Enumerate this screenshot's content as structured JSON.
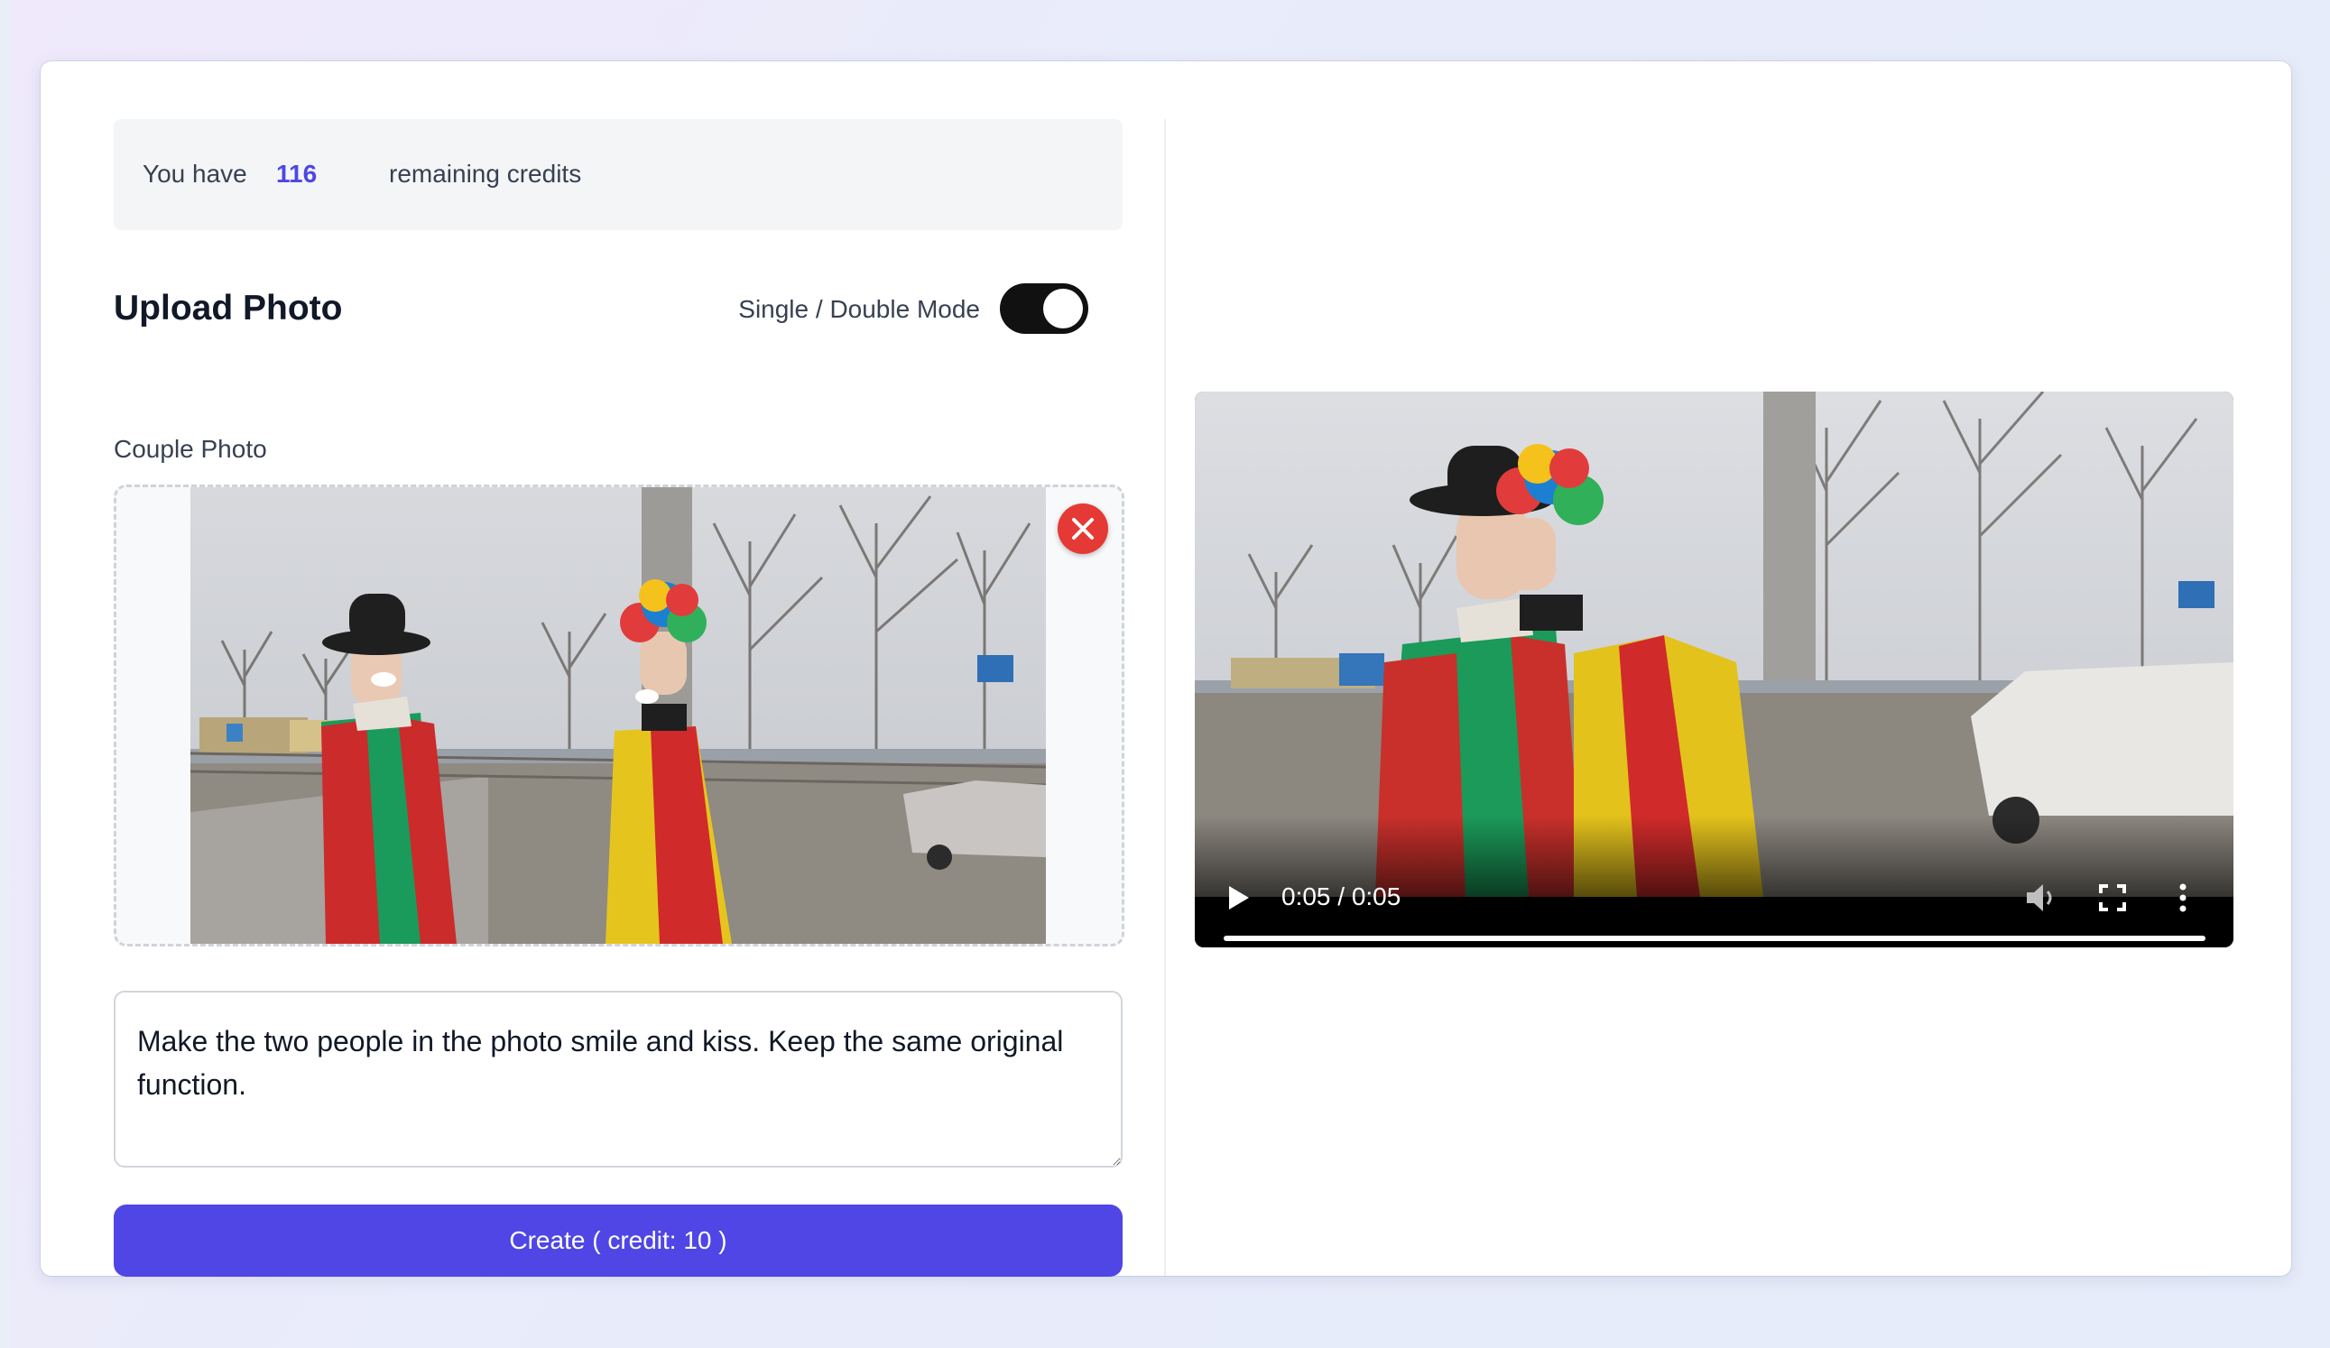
{
  "credits": {
    "prefix": "You have",
    "count": "116",
    "suffix": "remaining credits"
  },
  "upload": {
    "title": "Upload Photo",
    "mode_label": "Single / Double Mode",
    "mode_on": true,
    "photo_label": "Couple Photo"
  },
  "prompt": {
    "value": "Make the two people in the photo smile and kiss. Keep the same original function."
  },
  "create_button": {
    "label": "Create ( credit: 10 )"
  },
  "video": {
    "time": "0:05 / 0:05",
    "progress": 1.0
  },
  "colors": {
    "accent": "#4f46e5",
    "remove": "#e53935"
  },
  "icons": [
    "close-icon",
    "play-icon",
    "mute-icon",
    "fullscreen-icon",
    "more-vertical-icon"
  ]
}
